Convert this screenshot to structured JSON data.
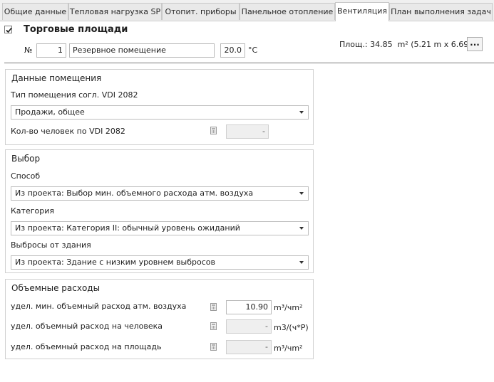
{
  "tabs": [
    {
      "label": "Общие данные",
      "active": false
    },
    {
      "label": "Тепловая нагрузка SP",
      "active": false
    },
    {
      "label": "Отопит. приборы",
      "active": false
    },
    {
      "label": "Панельное отопление",
      "active": false
    },
    {
      "label": "Вентиляция",
      "active": true
    },
    {
      "label": "План выполнения задач",
      "active": false
    }
  ],
  "room": {
    "title": "Торговые площади",
    "checked": true,
    "number_label": "№",
    "number": "1",
    "name": "Резервное помещение",
    "temperature": "20.0",
    "temperature_unit": "°C",
    "area_prefix": "Площ.: 34.85",
    "area_unit": "m²",
    "area_dims": "(5.21 m x 6.69 m)",
    "more_button": "..."
  },
  "room_data": {
    "title": "Данные помещения",
    "type_label": "Тип помещения согл. VDI 2082",
    "type_value": "Продажи, общее",
    "persons_label": "Кол-во человек по VDI 2082",
    "persons_value": "-"
  },
  "selection": {
    "title": "Выбор",
    "method_label": "Способ",
    "method_value": "Из проекта: Выбор мин. объемного расхода атм. воздуха",
    "category_label": "Категория",
    "category_value": "Из проекта: Категория II: обычный уровень ожиданий",
    "emissions_label": "Выбросы от здания",
    "emissions_value": "Из проекта: Здание с низким уровнем выбросов"
  },
  "flows": {
    "title": "Объемные расходы",
    "rows": [
      {
        "label": "удел. мин. объемный расход атм. воздуха",
        "value": "10.90",
        "unit": "m³/чm²",
        "disabled": false
      },
      {
        "label": "удел. объемный расход на человека",
        "value": "-",
        "unit": "m3/(ч*P)",
        "disabled": true
      },
      {
        "label": "удел. объемный расход на площадь",
        "value": "-",
        "unit": "m³/чm²",
        "disabled": true
      }
    ]
  }
}
